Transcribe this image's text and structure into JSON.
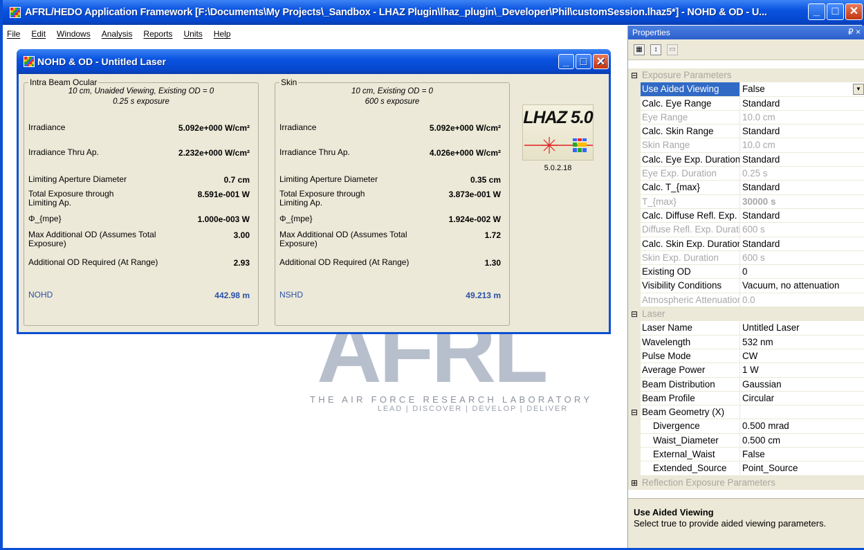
{
  "app": {
    "title": "AFRL/HEDO Application Framework [F:\\Documents\\My Projects\\_Sandbox - LHAZ Plugin\\lhaz_plugin\\_Developer\\Phil\\customSession.lhaz5*] - NOHD & OD - U...",
    "window_buttons": {
      "minimize": "_",
      "maximize": "□",
      "close": "✕"
    },
    "menu": [
      "File",
      "Edit",
      "Windows",
      "Analysis",
      "Reports",
      "Units",
      "Help"
    ]
  },
  "watermark": {
    "logo_text": "AFRL",
    "line1": "THE AIR FORCE RESEARCH LABORATORY",
    "line2": "LEAD | DISCOVER | DEVELOP | DELIVER"
  },
  "child_window": {
    "title": "NOHD & OD - Untitled Laser",
    "ocular": {
      "legend": "Intra Beam Ocular",
      "condition1": "10 cm, Unaided Viewing, Existing OD = 0",
      "condition2": "0.25 s exposure",
      "rows": [
        {
          "label": "Irradiance",
          "value": "5.092e+000 W/cm²"
        },
        {
          "label": "Irradiance Thru Ap.",
          "value": "2.232e+000 W/cm²"
        },
        {
          "label": "Limiting Aperture Diameter",
          "value": "0.7 cm"
        },
        {
          "label": "Total Exposure through Limiting Ap.",
          "value": "8.591e-001 W"
        },
        {
          "label": "Φ_{mpe}",
          "value": "1.000e-003 W"
        },
        {
          "label": "Max Additional OD (Assumes Total Exposure)",
          "value": "3.00"
        },
        {
          "label": "Additional OD Required (At Range)",
          "value": "2.93"
        }
      ],
      "result_label": "NOHD",
      "result_value": "442.98 m"
    },
    "skin": {
      "legend": "Skin",
      "condition1": "10 cm, Existing OD = 0",
      "condition2": "600 s exposure",
      "rows": [
        {
          "label": "Irradiance",
          "value": "5.092e+000 W/cm²"
        },
        {
          "label": "Irradiance Thru Ap.",
          "value": "4.026e+000 W/cm²"
        },
        {
          "label": "Limiting Aperture Diameter",
          "value": "0.35 cm"
        },
        {
          "label": "Total Exposure through Limiting Ap.",
          "value": "3.873e-001 W"
        },
        {
          "label": "Φ_{mpe}",
          "value": "1.924e-002 W"
        },
        {
          "label": "Max Additional OD (Assumes Total Exposure)",
          "value": "1.72"
        },
        {
          "label": "Additional OD Required (At Range)",
          "value": "1.30"
        }
      ],
      "result_label": "NSHD",
      "result_value": "49.213 m"
    },
    "logo_text": "LHAZ 5.0",
    "version": "5.0.2.18"
  },
  "properties": {
    "title": "Properties",
    "pin": "₽ ×",
    "rows": [
      {
        "kind": "cat",
        "expander": "⊟",
        "name": "Exposure Parameters"
      },
      {
        "kind": "sel",
        "name": "Use Aided Viewing",
        "value": "False",
        "dropdown": true
      },
      {
        "kind": "norm",
        "name": "Calc. Eye Range",
        "value": "Standard"
      },
      {
        "kind": "dim",
        "name": "Eye Range",
        "value": "10.0 cm"
      },
      {
        "kind": "norm",
        "name": "Calc. Skin Range",
        "value": "Standard"
      },
      {
        "kind": "dim",
        "name": "Skin Range",
        "value": "10.0 cm"
      },
      {
        "kind": "norm",
        "name": "Calc. Eye Exp. Duration",
        "value": "Standard"
      },
      {
        "kind": "dim",
        "name": "Eye Exp. Duration",
        "value": "0.25 s"
      },
      {
        "kind": "norm",
        "name": "Calc. T_{max}",
        "value": "Standard"
      },
      {
        "kind": "dim",
        "name": "T_{max}",
        "value": "30000 s",
        "bold": true
      },
      {
        "kind": "norm",
        "name": "Calc. Diffuse Refl. Exp. Duration",
        "value": "Standard"
      },
      {
        "kind": "dim",
        "name": "Diffuse Refl. Exp. Duration",
        "value": "600 s"
      },
      {
        "kind": "norm",
        "name": "Calc. Skin Exp. Duration",
        "value": "Standard"
      },
      {
        "kind": "dim",
        "name": "Skin Exp. Duration",
        "value": "600 s"
      },
      {
        "kind": "norm",
        "name": "Existing OD",
        "value": "0"
      },
      {
        "kind": "norm",
        "name": "Visibility Conditions",
        "value": "Vacuum, no attenuation"
      },
      {
        "kind": "dim",
        "name": "Atmospheric Attenuation",
        "value": "0.0"
      },
      {
        "kind": "cat",
        "expander": "⊟",
        "name": "Laser"
      },
      {
        "kind": "norm",
        "name": "Laser Name",
        "value": "Untitled Laser"
      },
      {
        "kind": "norm",
        "name": "Wavelength",
        "value": "532 nm"
      },
      {
        "kind": "norm",
        "name": "Pulse Mode",
        "value": "CW"
      },
      {
        "kind": "norm",
        "name": "Average Power",
        "value": "1 W"
      },
      {
        "kind": "norm",
        "name": "Beam Distribution",
        "value": "Gaussian"
      },
      {
        "kind": "norm",
        "name": "Beam Profile",
        "value": "Circular"
      },
      {
        "kind": "group",
        "expander": "⊟",
        "name": "Beam Geometry (X)",
        "value": ""
      },
      {
        "kind": "sub",
        "name": "Divergence",
        "value": "0.500 mrad"
      },
      {
        "kind": "sub",
        "name": "Waist_Diameter",
        "value": "0.500 cm"
      },
      {
        "kind": "sub",
        "name": "External_Waist",
        "value": "False"
      },
      {
        "kind": "sub",
        "name": "Extended_Source",
        "value": "Point_Source"
      },
      {
        "kind": "cat",
        "expander": "⊞",
        "name": "Reflection Exposure Parameters"
      }
    ],
    "description": {
      "title": "Use Aided Viewing",
      "text": "Select true to provide aided viewing parameters."
    }
  }
}
